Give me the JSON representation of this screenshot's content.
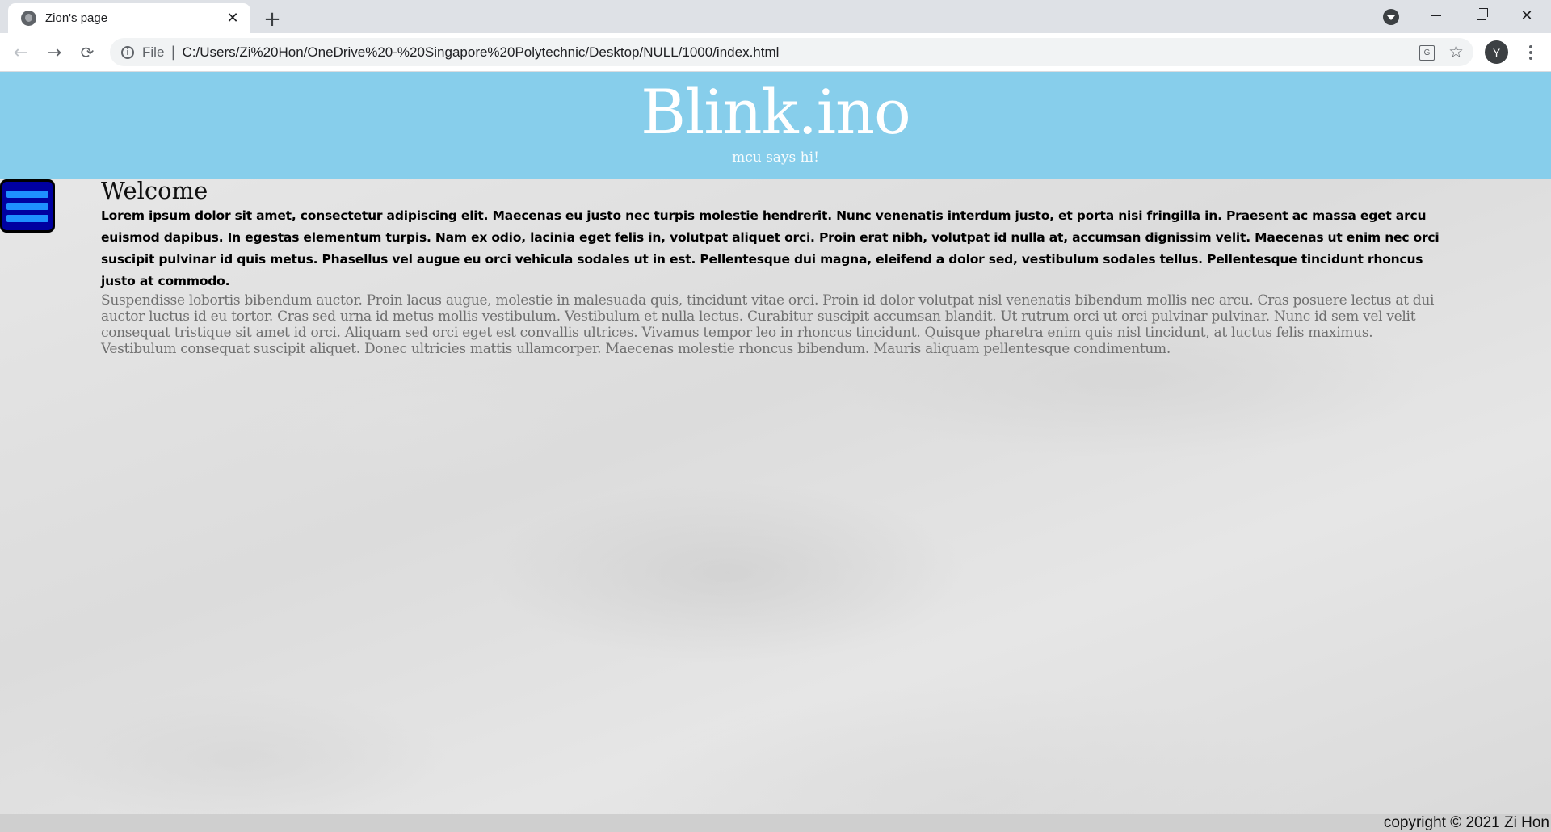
{
  "browser": {
    "tab": {
      "title": "Zion's page",
      "close": "✕"
    },
    "new_tab": "+",
    "nav": {
      "back": "←",
      "forward": "→",
      "reload": "⟳"
    },
    "address": {
      "info": "i",
      "scheme": "File",
      "separator": "|",
      "url": "C:/Users/Zi%20Hon/OneDrive%20-%20Singapore%20Polytechnic/Desktop/NULL/1000/index.html"
    },
    "translate": "G",
    "star": "☆",
    "avatar_letter": "Y",
    "window_close": "✕"
  },
  "site": {
    "title": "Blink.ino",
    "tagline": "mcu says hi!",
    "heading": "Welcome",
    "lead": "Lorem ipsum dolor sit amet, consectetur adipiscing elit. Maecenas eu justo nec turpis molestie hendrerit. Nunc venenatis interdum justo, et porta nisi fringilla in. Praesent ac massa eget arcu euismod dapibus. In egestas elementum turpis. Nam ex odio, lacinia eget felis in, volutpat aliquet orci. Proin erat nibh, volutpat id nulla at, accumsan dignissim velit. Maecenas ut enim nec orci suscipit pulvinar id quis metus. Phasellus vel augue eu orci vehicula sodales ut in est. Pellentesque dui magna, eleifend a dolor sed, vestibulum sodales tellus. Pellentesque tincidunt rhoncus justo at commodo.",
    "body": "Suspendisse lobortis bibendum auctor. Proin lacus augue, molestie in malesuada quis, tincidunt vitae orci. Proin id dolor volutpat nisl venenatis bibendum mollis nec arcu. Cras posuere lectus at dui auctor luctus id eu tortor. Cras sed urna id metus mollis vestibulum. Vestibulum et nulla lectus. Curabitur suscipit accumsan blandit. Ut rutrum orci ut orci pulvinar pulvinar. Nunc id sem vel velit consequat tristique sit amet id orci. Aliquam sed orci eget est convallis ultrices. Vivamus tempor leo in rhoncus tincidunt. Quisque pharetra enim quis nisl tincidunt, at luctus felis maximus. Vestibulum consequat suscipit aliquet. Donec ultricies mattis ullamcorper. Maecenas molestie rhoncus bibendum. Mauris aliquam pellentesque condimentum.",
    "copyright": "copyright © 2021 Zi Hon"
  },
  "colors": {
    "header_bg": "#87ceeb",
    "menu_bg": "#0000a0",
    "menu_bars": "#1e90ff"
  }
}
